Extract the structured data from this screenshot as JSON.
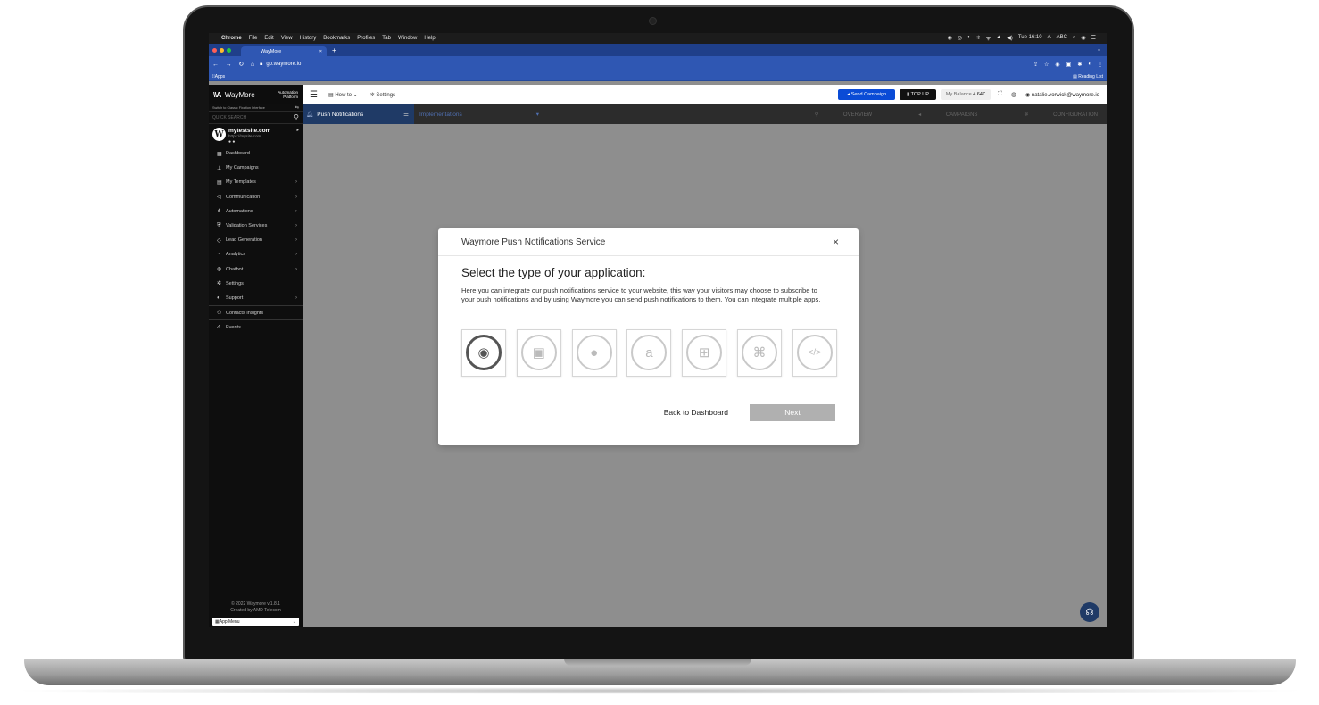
{
  "menubar": {
    "apple": "",
    "items": [
      "Chrome",
      "File",
      "Edit",
      "View",
      "History",
      "Bookmarks",
      "Profiles",
      "Tab",
      "Window",
      "Help"
    ],
    "status": [
      "◉",
      "◎",
      "◐",
      "⁜",
      "ᯤ",
      "▲",
      "◀)",
      "Tue 16:10",
      "A",
      "ABC",
      "⌕",
      "◉",
      "☰"
    ]
  },
  "browser": {
    "tab_title": "WayMore",
    "tab_close": "×",
    "new_tab": "+",
    "url": "go.waymore.io",
    "bookmarks": "Apps",
    "reading_list": "Reading List"
  },
  "topbar": {
    "logo": "\\\\A",
    "brand": "WayMore",
    "tag_line1": "Automation",
    "tag_line2": "Platform",
    "howto": "How to",
    "settings": "Settings",
    "send_campaign": "Send Campaign",
    "top_up": "TOP UP",
    "balance_label": "My Balance",
    "balance_value": "4.64€",
    "user_email": "natalie.vorwick@waymore.io"
  },
  "sidebar": {
    "switch_text": "Switch to Classic Fixation Interface",
    "search_placeholder": "QUICK SEARCH",
    "site_name": "mytestsite.com",
    "site_url": "https://mysite.com",
    "items": [
      {
        "label": "Dashboard",
        "icon": "▦",
        "chevron": ""
      },
      {
        "label": "My Campaigns",
        "icon": "⊥",
        "chevron": ""
      },
      {
        "label": "My Templates",
        "icon": "▤",
        "chevron": "›"
      },
      {
        "label": "Communication",
        "icon": "◁",
        "chevron": "›"
      },
      {
        "label": "Automations",
        "icon": "⋔",
        "chevron": "›"
      },
      {
        "label": "Validation Services",
        "icon": "⛨",
        "chevron": "›"
      },
      {
        "label": "Lead Generation",
        "icon": "◇",
        "chevron": "›"
      },
      {
        "label": "Analytics",
        "icon": "◔",
        "chevron": "›"
      },
      {
        "label": "Chatbot",
        "icon": "◍",
        "chevron": "›"
      },
      {
        "label": "Settings",
        "icon": "✲",
        "chevron": ""
      },
      {
        "label": "Support",
        "icon": "◐",
        "chevron": "›"
      }
    ],
    "contacts_insights": "Contacts Insights",
    "events": "Events",
    "footer_line1": "© 2022 Waymore v.1.8.1",
    "footer_line2": "Created by AMD Telecom",
    "app_menu": "App Menu"
  },
  "subheader": {
    "push_notifications": "Push Notifications",
    "implementations": "Implementations",
    "overview": "OVERVIEW",
    "campaigns": "CAMPAIGNS",
    "configuration": "CONFIGURATION"
  },
  "modal": {
    "header": "Waymore Push Notifications Service",
    "close": "×",
    "title": "Select the type of your application:",
    "description": "Here you can integrate our push notifications service to your website, this way your visitors may choose to subscribe to your push notifications and by using Waymore you can send push notifications to them. You can integrate multiple apps.",
    "apps": [
      {
        "name": "chrome-icon",
        "glyph": "◉",
        "selected": true
      },
      {
        "name": "android-icon",
        "glyph": "▣",
        "selected": false
      },
      {
        "name": "apple-icon",
        "glyph": "●",
        "selected": false
      },
      {
        "name": "amazon-icon",
        "glyph": "a",
        "selected": false
      },
      {
        "name": "windows-icon",
        "glyph": "⊞",
        "selected": false
      },
      {
        "name": "other-platform-icon",
        "glyph": "⌘",
        "selected": false
      },
      {
        "name": "code-icon",
        "glyph": "</>",
        "selected": false
      }
    ],
    "back_label": "Back to Dashboard",
    "next_label": "Next"
  }
}
